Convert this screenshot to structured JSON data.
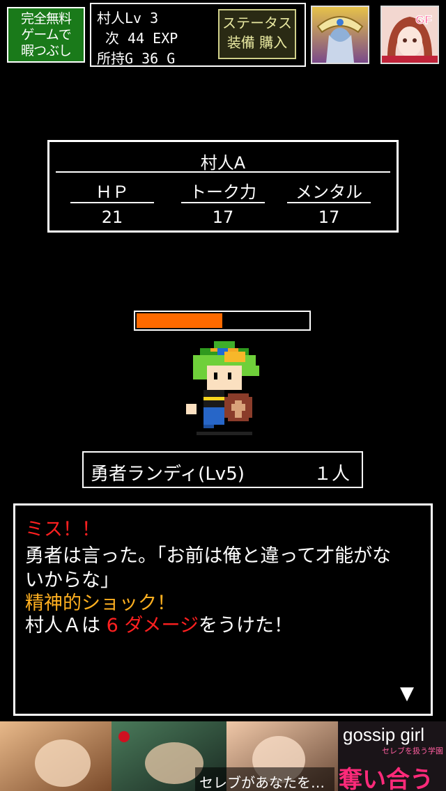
{
  "top_bar": {
    "free_game": {
      "line1": "完全無料",
      "line2": "ゲームで",
      "line3": "暇つぶし"
    },
    "player": {
      "level_line": "村人Lv 3",
      "exp_line": "次 44 EXP",
      "gold_line": "所持G 36 G"
    },
    "status_button": {
      "line1": "ステータス",
      "line2": "装備 購入"
    },
    "app_icon_2_badge": "GF"
  },
  "enemy": {
    "name": "村人A",
    "stats": [
      {
        "label": "ＨＰ",
        "value": "21"
      },
      {
        "label": "トーク力",
        "value": "17"
      },
      {
        "label": "メンタル",
        "value": "17"
      }
    ]
  },
  "hp_bar": {
    "fill_fraction": 0.5,
    "color": "#ff6a00"
  },
  "hero": {
    "name": "勇者ランディ(Lv5)",
    "count": "１人"
  },
  "messages": {
    "line1": "ミス！！",
    "line2": "勇者は言った。「お前は俺と違って才能がな",
    "line3": "いからな」",
    "line4": "精神的ショック！",
    "line5_a": "村人Ａは ",
    "line5_b": "6 ダメージ",
    "line5_c": "をうけた！",
    "next_indicator": "▼"
  },
  "ad_banner": {
    "brand": "gossip girl",
    "tagline": "セレブを扱う学園",
    "text1": "セレブがあなたを…",
    "text2": "奪い合う"
  }
}
